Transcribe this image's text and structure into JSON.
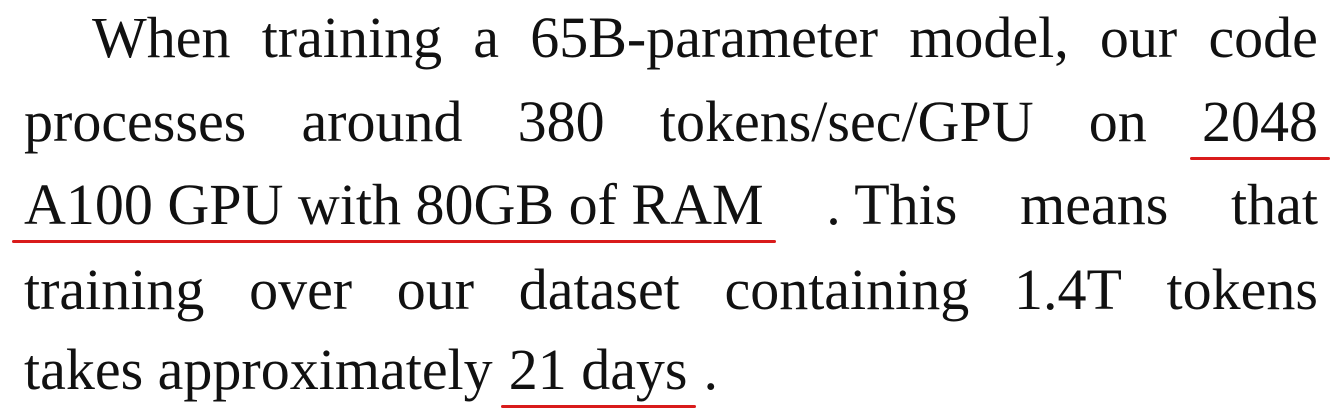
{
  "paragraph": {
    "line1": [
      "When",
      "training",
      "a",
      "65B-parameter",
      "model,",
      "our",
      "code"
    ],
    "line2_words": [
      "processes",
      "around",
      "380",
      "tokens/sec/GPU",
      "on"
    ],
    "line2_highlight": "2048",
    "line3_highlight": "A100 GPU with 80GB of RAM",
    "line3_after": [
      ". This",
      "means",
      "that"
    ],
    "line4": [
      "training",
      "over",
      "our",
      "dataset",
      "containing",
      "1.4T",
      "tokens"
    ],
    "line5_prefix": "takes approximately",
    "line5_highlight": "21 days",
    "line5_suffix": "."
  },
  "colors": {
    "text": "#111111",
    "underline": "#d91b1b"
  }
}
